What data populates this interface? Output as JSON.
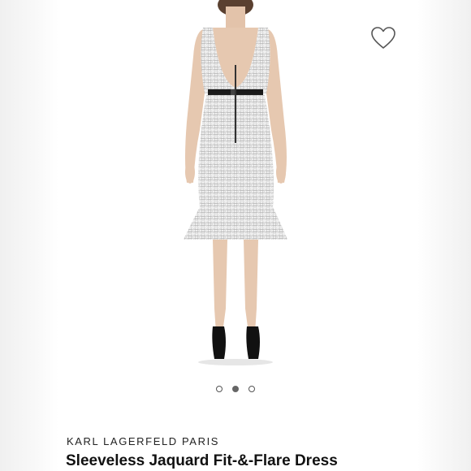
{
  "product": {
    "brand": "KARL LAGERFELD PARIS",
    "title": "Sleeveless Jaquard Fit-&-Flare Dress",
    "image_description": "Back view of sleeveless white tweed fit-and-flare dress with black belt"
  },
  "carousel": {
    "total_images": 3,
    "active_index": 2
  },
  "icons": {
    "wishlist": "heart-outline-icon"
  },
  "colors": {
    "background": "#ffffff",
    "dress": "#ececec",
    "belt": "#1a1a1a",
    "skin": "#e8cbb4",
    "shoes": "#111111",
    "active_dot": "#666666"
  }
}
